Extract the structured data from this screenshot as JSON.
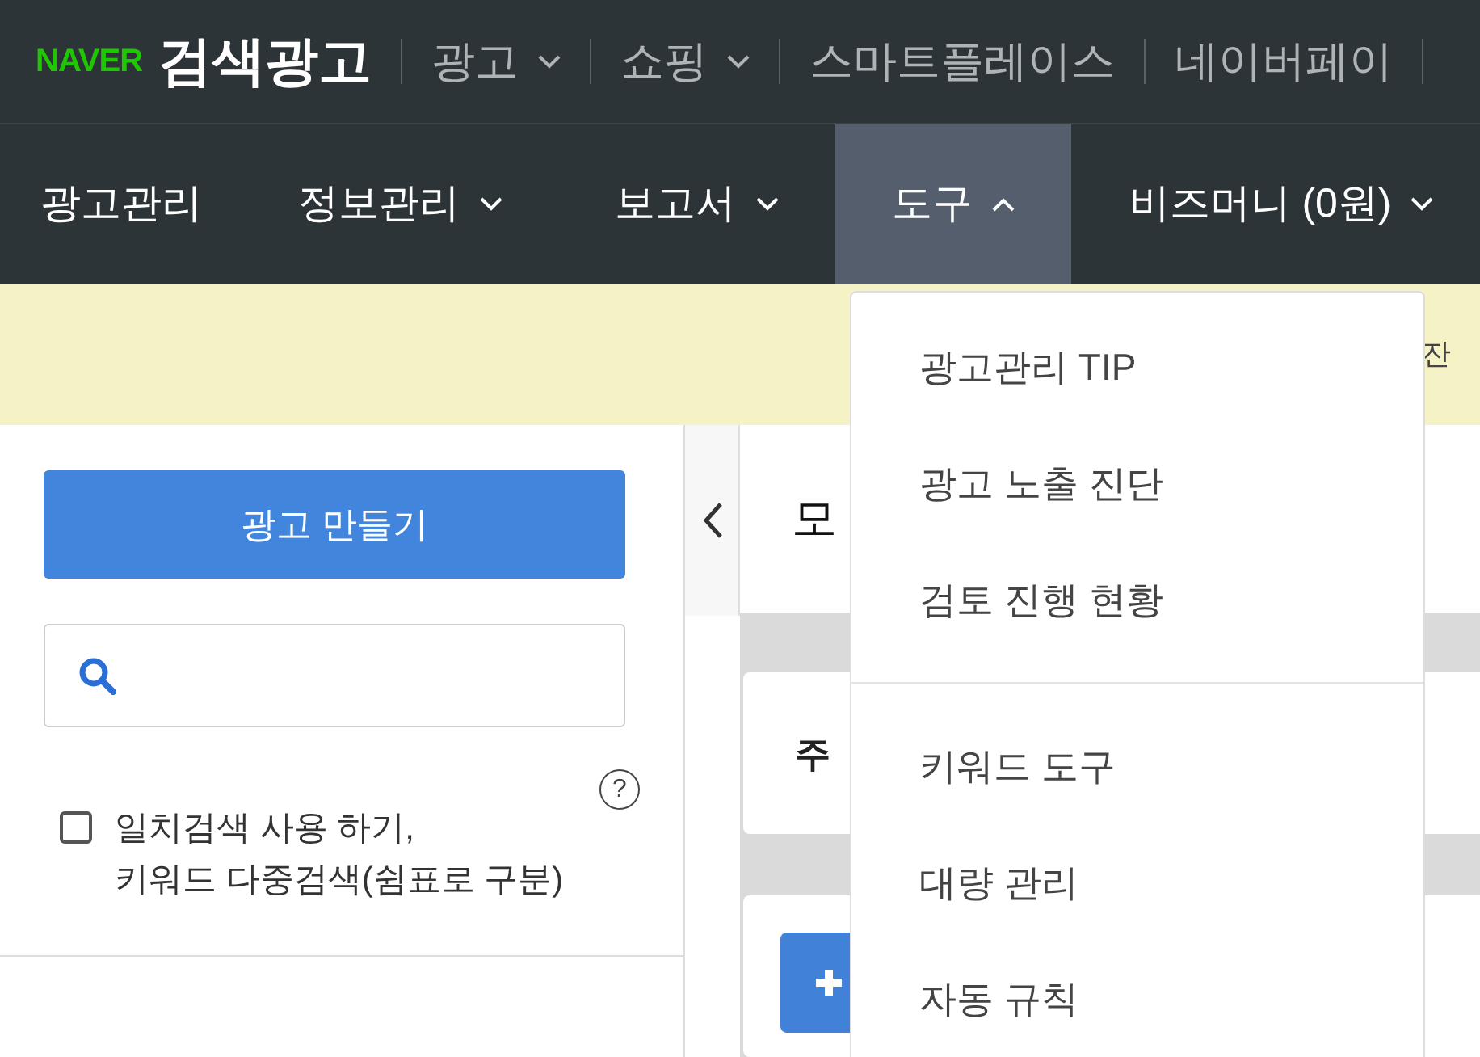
{
  "header": {
    "logo": "NAVER",
    "product": "검색광고",
    "links": [
      {
        "label": "광고",
        "dropdown": true
      },
      {
        "label": "쇼핑",
        "dropdown": true
      },
      {
        "label": "스마트플레이스",
        "dropdown": false
      },
      {
        "label": "네이버페이",
        "dropdown": false
      }
    ]
  },
  "nav": [
    {
      "label": "광고관리",
      "dropdown": false,
      "selected": false
    },
    {
      "label": "정보관리",
      "dropdown": true,
      "selected": false
    },
    {
      "label": "보고서",
      "dropdown": true,
      "selected": false
    },
    {
      "label": "도구",
      "dropdown": true,
      "selected": true
    },
    {
      "label": "비즈머니 (0원)",
      "dropdown": true,
      "selected": false
    }
  ],
  "notice": {
    "text": "잔"
  },
  "menu": {
    "groups": [
      [
        "광고관리 TIP",
        "광고 노출 진단",
        "검토 진행 현황"
      ],
      [
        "키워드 도구",
        "대량 관리",
        "자동 규칙"
      ]
    ]
  },
  "sidebar": {
    "create_button": "광고 만들기",
    "exact_match": {
      "checked": false,
      "label": "일치검색 사용 하기,\n키워드 다중검색(쉼표로 구분)"
    },
    "help": "?"
  },
  "content": {
    "title": "모",
    "card_title": "주"
  }
}
